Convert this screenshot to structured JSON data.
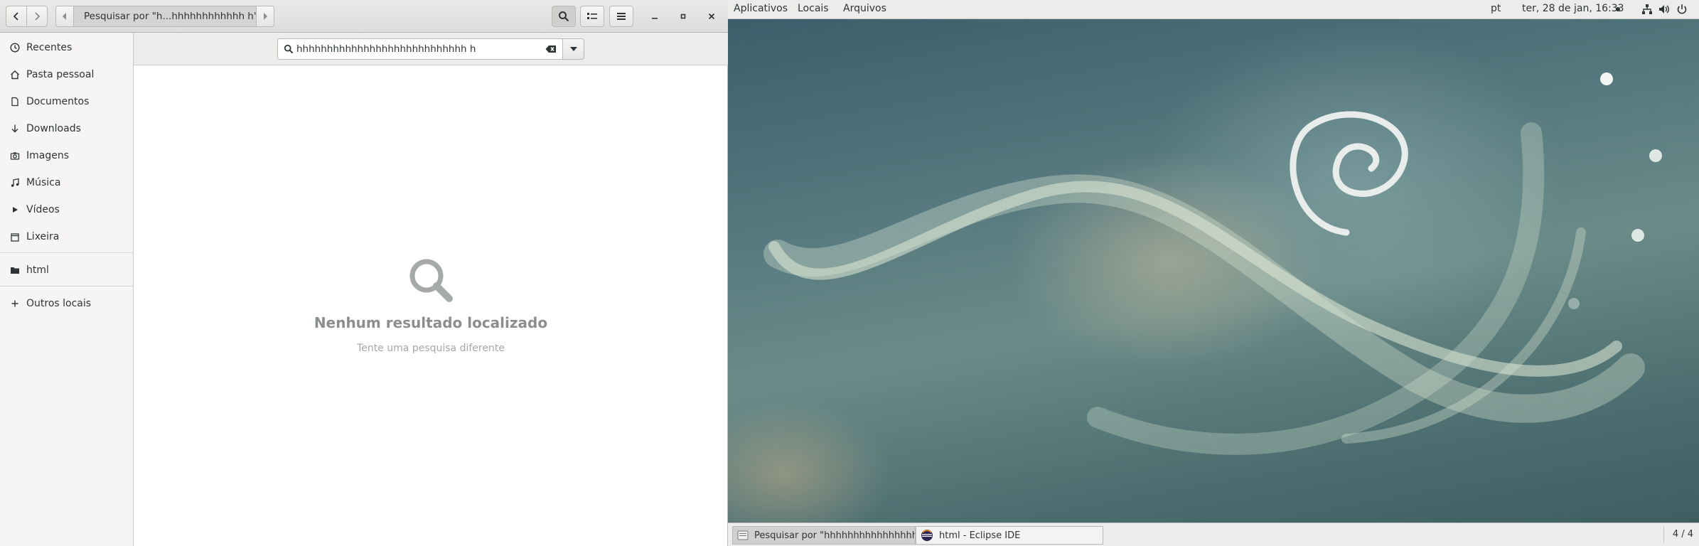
{
  "files_window": {
    "path_crumb": "Pesquisar por \"h...hhhhhhhhhhhh h\"",
    "search": {
      "value": "hhhhhhhhhhhhhhhhhhhhhhhhhhhh h"
    },
    "sidebar": {
      "items": [
        {
          "label": "Recentes",
          "icon": "clock-icon"
        },
        {
          "label": "Pasta pessoal",
          "icon": "home-icon"
        },
        {
          "label": "Documentos",
          "icon": "document-icon"
        },
        {
          "label": "Downloads",
          "icon": "download-icon"
        },
        {
          "label": "Imagens",
          "icon": "camera-icon"
        },
        {
          "label": "Música",
          "icon": "music-icon"
        },
        {
          "label": "Vídeos",
          "icon": "video-icon"
        },
        {
          "label": "Lixeira",
          "icon": "trash-icon"
        },
        {
          "label": "html",
          "icon": "folder-icon"
        },
        {
          "label": "Outros locais",
          "icon": "plus-icon"
        }
      ]
    },
    "empty_state": {
      "title": "Nenhum resultado localizado",
      "subtitle": "Tente uma pesquisa diferente"
    }
  },
  "desktop": {
    "topbar": {
      "applications": "Aplicativos",
      "places": "Locais",
      "files": "Arquivos",
      "keyboard_layout": "pt",
      "clock": "ter, 28 de jan, 16:33"
    },
    "taskbar": {
      "tasks": [
        {
          "label": "Pesquisar por \"hhhhhhhhhhhhhhhhhh...",
          "icon": "files-app-icon"
        },
        {
          "label": "html - Eclipse IDE",
          "icon": "eclipse-icon"
        }
      ],
      "workspace": "4 / 4"
    },
    "colors": {
      "panel": "#ececeb",
      "wallpaper_base": "#577b80"
    }
  }
}
